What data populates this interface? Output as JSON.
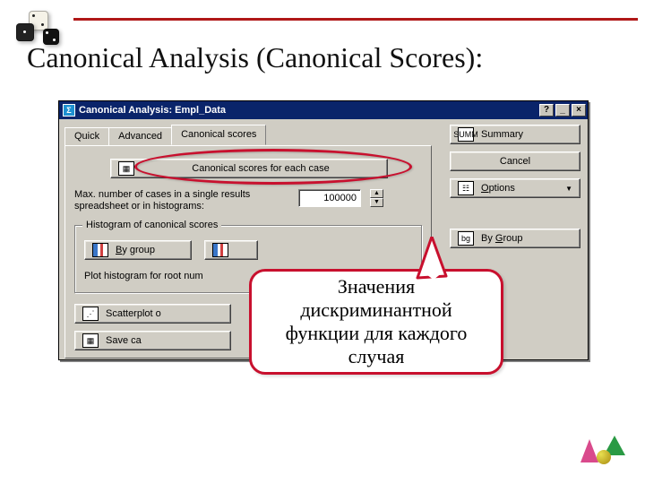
{
  "slide": {
    "title": "Canonical Analysis (Canonical Scores):"
  },
  "dialog": {
    "title": "Canonical Analysis: Empl_Data",
    "win_buttons": {
      "help": "?",
      "min": "_",
      "close": "×"
    },
    "tabs": {
      "quick": "Quick",
      "advanced": "Advanced",
      "scores": "Canonical scores"
    },
    "scores_button": "Canonical scores for each case",
    "max_label": "Max. number of cases in a single results spreadsheet or in histograms:",
    "max_value": "100000",
    "hist_group_legend": "Histogram of canonical scores",
    "by_group_btn": "By group",
    "combined_btn": "",
    "plot_label": "Plot histogram for root num",
    "scatter_btn": "Scatterplot o",
    "save_btn": "Save ca",
    "right": {
      "summary": "Summary",
      "cancel": "Cancel",
      "options": "Options",
      "by_group": "By Group"
    }
  },
  "callout": {
    "text": "Значения дискриминантной функции для каждого случая"
  }
}
